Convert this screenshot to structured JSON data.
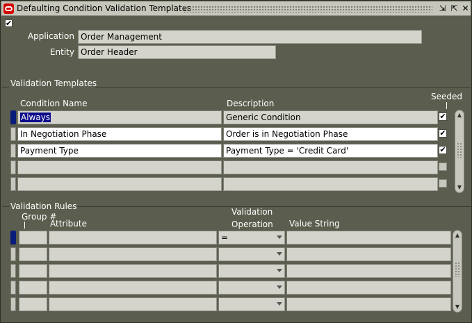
{
  "window": {
    "title": "Defaulting Condition Validation Templates",
    "minimize_glyph": "⇲",
    "maximize_glyph": "⇱",
    "close_glyph": "✕",
    "logo_icon": "oracle-logo-icon"
  },
  "header": {
    "application_label": "Application",
    "application_value": "Order Management",
    "entity_label": "Entity",
    "entity_value": "Order Header"
  },
  "templates": {
    "section_title": "Validation Templates",
    "col_condition": "Condition Name",
    "col_description": "Description",
    "col_seeded": "Seeded",
    "rows": [
      {
        "condition": "Always",
        "description": "Generic Condition",
        "seeded": true
      },
      {
        "condition": "In Negotiation Phase",
        "description": "Order is in Negotiation Phase",
        "seeded": true
      },
      {
        "condition": "Payment Type",
        "description": "Payment Type = 'Credit Card'",
        "seeded": true
      },
      {
        "condition": "",
        "description": "",
        "seeded": false
      },
      {
        "condition": "",
        "description": "",
        "seeded": false
      }
    ]
  },
  "rules": {
    "section_title": "Validation Rules",
    "col_group": "Group #",
    "col_attribute": "Attribute",
    "col_operation_line1": "Validation",
    "col_operation_line2": "Operation",
    "col_value": "Value String",
    "rows": [
      {
        "group": "",
        "attribute": "",
        "operation": "=",
        "value": ""
      },
      {
        "group": "",
        "attribute": "",
        "operation": "",
        "value": ""
      },
      {
        "group": "",
        "attribute": "",
        "operation": "",
        "value": ""
      },
      {
        "group": "",
        "attribute": "",
        "operation": "",
        "value": ""
      },
      {
        "group": "",
        "attribute": "",
        "operation": "",
        "value": ""
      }
    ]
  },
  "colors": {
    "background": "#5b5e4e",
    "field": "#d4d4cc",
    "selection": "#0a0a8a"
  }
}
